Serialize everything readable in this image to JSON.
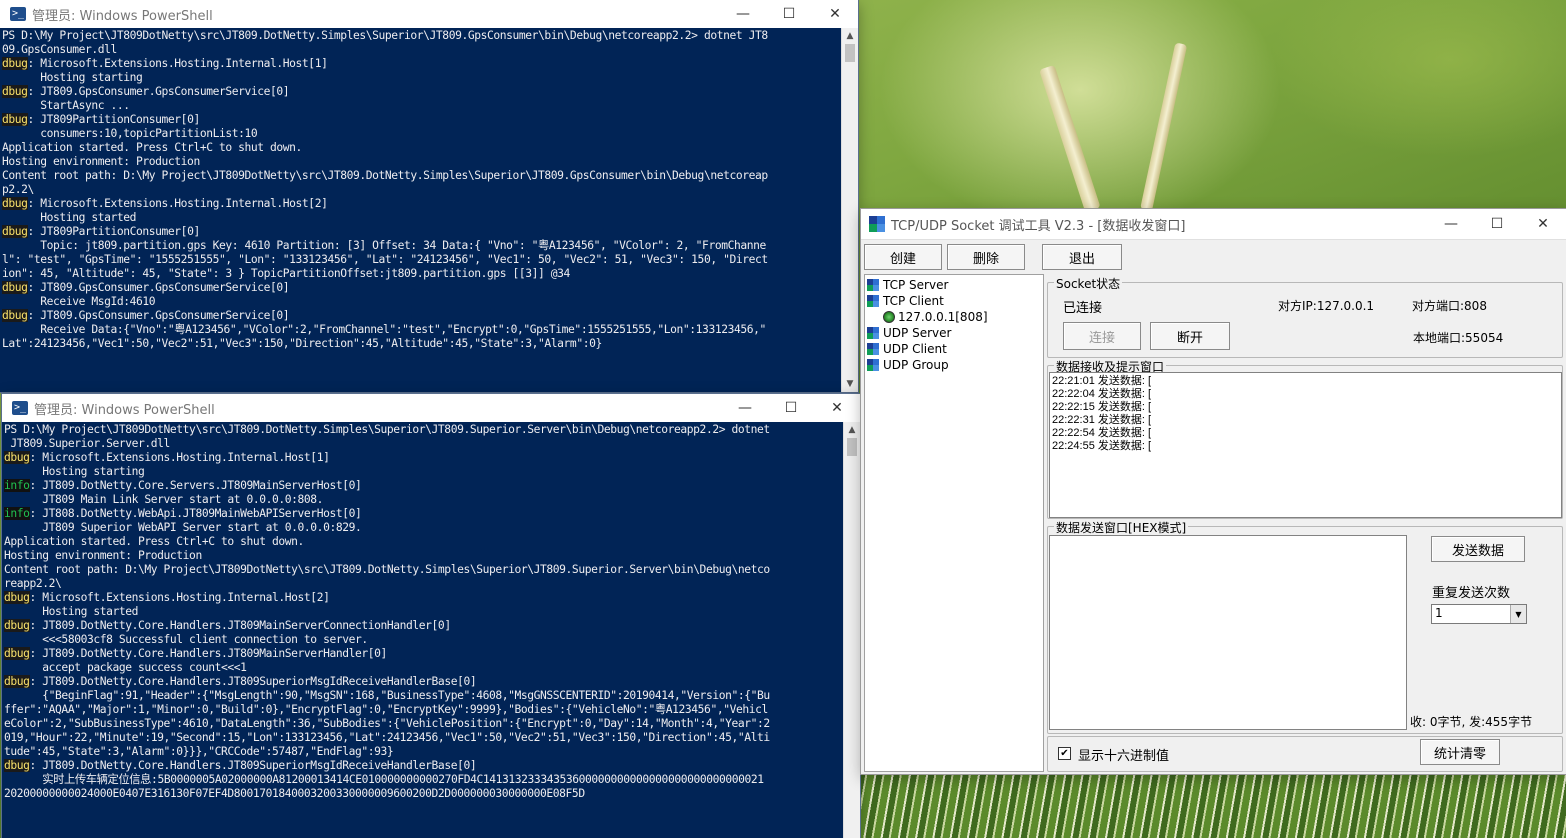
{
  "desktop": {
    "label": "desktop"
  },
  "ps1": {
    "title": "管理员: Windows PowerShell",
    "lines": [
      {
        "tag": "",
        "text": "PS D:\\My Project\\JT809DotNetty\\src\\JT809.DotNetty.Simples\\Superior\\JT809.GpsConsumer\\bin\\Debug\\netcoreapp2.2> dotnet JT8"
      },
      {
        "tag": "",
        "text": "09.GpsConsumer.dll"
      },
      {
        "tag": "dbug",
        "text": ": Microsoft.Extensions.Hosting.Internal.Host[1]"
      },
      {
        "tag": "",
        "text": "      Hosting starting"
      },
      {
        "tag": "dbug",
        "text": ": JT809.GpsConsumer.GpsConsumerService[0]"
      },
      {
        "tag": "",
        "text": "      StartAsync ..."
      },
      {
        "tag": "dbug",
        "text": ": JT809PartitionConsumer[0]"
      },
      {
        "tag": "",
        "text": "      consumers:10,topicPartitionList:10"
      },
      {
        "tag": "",
        "text": "Application started. Press Ctrl+C to shut down."
      },
      {
        "tag": "",
        "text": "Hosting environment: Production"
      },
      {
        "tag": "",
        "text": "Content root path: D:\\My Project\\JT809DotNetty\\src\\JT809.DotNetty.Simples\\Superior\\JT809.GpsConsumer\\bin\\Debug\\netcoreap"
      },
      {
        "tag": "",
        "text": "p2.2\\"
      },
      {
        "tag": "dbug",
        "text": ": Microsoft.Extensions.Hosting.Internal.Host[2]"
      },
      {
        "tag": "",
        "text": "      Hosting started"
      },
      {
        "tag": "dbug",
        "text": ": JT809PartitionConsumer[0]"
      },
      {
        "tag": "",
        "text": "      Topic: jt809.partition.gps Key: 4610 Partition: [3] Offset: 34 Data:{ \"Vno\": \"粤A123456\", \"VColor\": 2, \"FromChanne"
      },
      {
        "tag": "",
        "text": "l\": \"test\", \"GpsTime\": \"1555251555\", \"Lon\": \"133123456\", \"Lat\": \"24123456\", \"Vec1\": 50, \"Vec2\": 51, \"Vec3\": 150, \"Direct"
      },
      {
        "tag": "",
        "text": "ion\": 45, \"Altitude\": 45, \"State\": 3 } TopicPartitionOffset:jt809.partition.gps [[3]] @34"
      },
      {
        "tag": "dbug",
        "text": ": JT809.GpsConsumer.GpsConsumerService[0]"
      },
      {
        "tag": "",
        "text": "      Receive MsgId:4610"
      },
      {
        "tag": "dbug",
        "text": ": JT809.GpsConsumer.GpsConsumerService[0]"
      },
      {
        "tag": "",
        "text": "      Receive Data:{\"Vno\":\"粤A123456\",\"VColor\":2,\"FromChannel\":\"test\",\"Encrypt\":0,\"GpsTime\":1555251555,\"Lon\":133123456,\""
      },
      {
        "tag": "",
        "text": "Lat\":24123456,\"Vec1\":50,\"Vec2\":51,\"Vec3\":150,\"Direction\":45,\"Altitude\":45,\"State\":3,\"Alarm\":0}"
      }
    ]
  },
  "ps2": {
    "title": "管理员: Windows PowerShell",
    "lines": [
      {
        "tag": "",
        "text": "PS D:\\My Project\\JT809DotNetty\\src\\JT809.DotNetty.Simples\\Superior\\JT809.Superior.Server\\bin\\Debug\\netcoreapp2.2> dotnet"
      },
      {
        "tag": "",
        "text": " JT809.Superior.Server.dll"
      },
      {
        "tag": "dbug",
        "text": ": Microsoft.Extensions.Hosting.Internal.Host[1]"
      },
      {
        "tag": "",
        "text": "      Hosting starting"
      },
      {
        "tag": "info",
        "text": ": JT809.DotNetty.Core.Servers.JT809MainServerHost[0]"
      },
      {
        "tag": "",
        "text": "      JT809 Main Link Server start at 0.0.0.0:808."
      },
      {
        "tag": "info",
        "text": ": JT808.DotNetty.WebApi.JT809MainWebAPIServerHost[0]"
      },
      {
        "tag": "",
        "text": "      JT809 Superior WebAPI Server start at 0.0.0.0:829."
      },
      {
        "tag": "",
        "text": "Application started. Press Ctrl+C to shut down."
      },
      {
        "tag": "",
        "text": "Hosting environment: Production"
      },
      {
        "tag": "",
        "text": "Content root path: D:\\My Project\\JT809DotNetty\\src\\JT809.DotNetty.Simples\\Superior\\JT809.Superior.Server\\bin\\Debug\\netco"
      },
      {
        "tag": "",
        "text": "reapp2.2\\"
      },
      {
        "tag": "dbug",
        "text": ": Microsoft.Extensions.Hosting.Internal.Host[2]"
      },
      {
        "tag": "",
        "text": "      Hosting started"
      },
      {
        "tag": "dbug",
        "text": ": JT809.DotNetty.Core.Handlers.JT809MainServerConnectionHandler[0]"
      },
      {
        "tag": "",
        "text": "      <<<58003cf8 Successful client connection to server."
      },
      {
        "tag": "dbug",
        "text": ": JT809.DotNetty.Core.Handlers.JT809MainServerHandler[0]"
      },
      {
        "tag": "",
        "text": "      accept package success count<<<1"
      },
      {
        "tag": "dbug",
        "text": ": JT809.DotNetty.Core.Handlers.JT809SuperiorMsgIdReceiveHandlerBase[0]"
      },
      {
        "tag": "",
        "text": "      {\"BeginFlag\":91,\"Header\":{\"MsgLength\":90,\"MsgSN\":168,\"BusinessType\":4608,\"MsgGNSSCENTERID\":20190414,\"Version\":{\"Bu"
      },
      {
        "tag": "",
        "text": "ffer\":\"AQAA\",\"Major\":1,\"Minor\":0,\"Build\":0},\"EncryptFlag\":0,\"EncryptKey\":9999},\"Bodies\":{\"VehicleNo\":\"粤A123456\",\"Vehicl"
      },
      {
        "tag": "",
        "text": "eColor\":2,\"SubBusinessType\":4610,\"DataLength\":36,\"SubBodies\":{\"VehiclePosition\":{\"Encrypt\":0,\"Day\":14,\"Month\":4,\"Year\":2"
      },
      {
        "tag": "",
        "text": "019,\"Hour\":22,\"Minute\":19,\"Second\":15,\"Lon\":133123456,\"Lat\":24123456,\"Vec1\":50,\"Vec2\":51,\"Vec3\":150,\"Direction\":45,\"Alti"
      },
      {
        "tag": "",
        "text": "tude\":45,\"State\":3,\"Alarm\":0}}},\"CRCCode\":57487,\"EndFlag\":93}"
      },
      {
        "tag": "dbug",
        "text": ": JT809.DotNetty.Core.Handlers.JT809SuperiorMsgIdReceiveHandlerBase[0]"
      },
      {
        "tag": "",
        "text": "      实时上传车辆定位信息:5B0000005A02000000A81200013414CE010000000000270FD4C14131323334353600000000000000000000000000021"
      },
      {
        "tag": "",
        "text": "20200000000024000E0407E316130F07EF4D8001701840003200330000009600200D2D000000030000000E08F5D"
      }
    ]
  },
  "socket": {
    "title": "TCP/UDP Socket 调试工具 V2.3 - [数据收发窗口]",
    "toolbar": {
      "create": "创建",
      "delete": "删除",
      "exit": "退出"
    },
    "tree": {
      "tcp_server": "TCP Server",
      "tcp_client": "TCP Client",
      "tcp_client_conn": "127.0.0.1[808]",
      "udp_server": "UDP Server",
      "udp_client": "UDP Client",
      "udp_group": "UDP Group"
    },
    "status": {
      "group_label": "Socket状态",
      "state": "已连接",
      "remote_ip": "对方IP:127.0.0.1",
      "remote_port": "对方端口:808",
      "local_port": "本地端口:55054",
      "connect": "连接",
      "disconnect": "断开"
    },
    "recv": {
      "group_label": "数据接收及提示窗口",
      "lines": [
        "22:21:01 发送数据: [",
        "22:22:04 发送数据: [",
        "22:22:15 发送数据: [",
        "22:22:31 发送数据: [",
        "22:22:54 发送数据: [",
        "22:24:55 发送数据: ["
      ]
    },
    "send": {
      "group_label": "数据发送窗口[HEX模式]",
      "send_button": "发送数据",
      "repeat_label": "重复发送次数",
      "repeat_value": "1",
      "stats": "收: 0字节, 发:455字节"
    },
    "bottom": {
      "hex_checkbox_label": "显示十六进制值",
      "hex_checked": "✔",
      "clear_button": "统计清零"
    },
    "icon_colors": [
      "#1c3f94",
      "#2f6fd1",
      "#0f9d58",
      "#4a90e2"
    ]
  }
}
